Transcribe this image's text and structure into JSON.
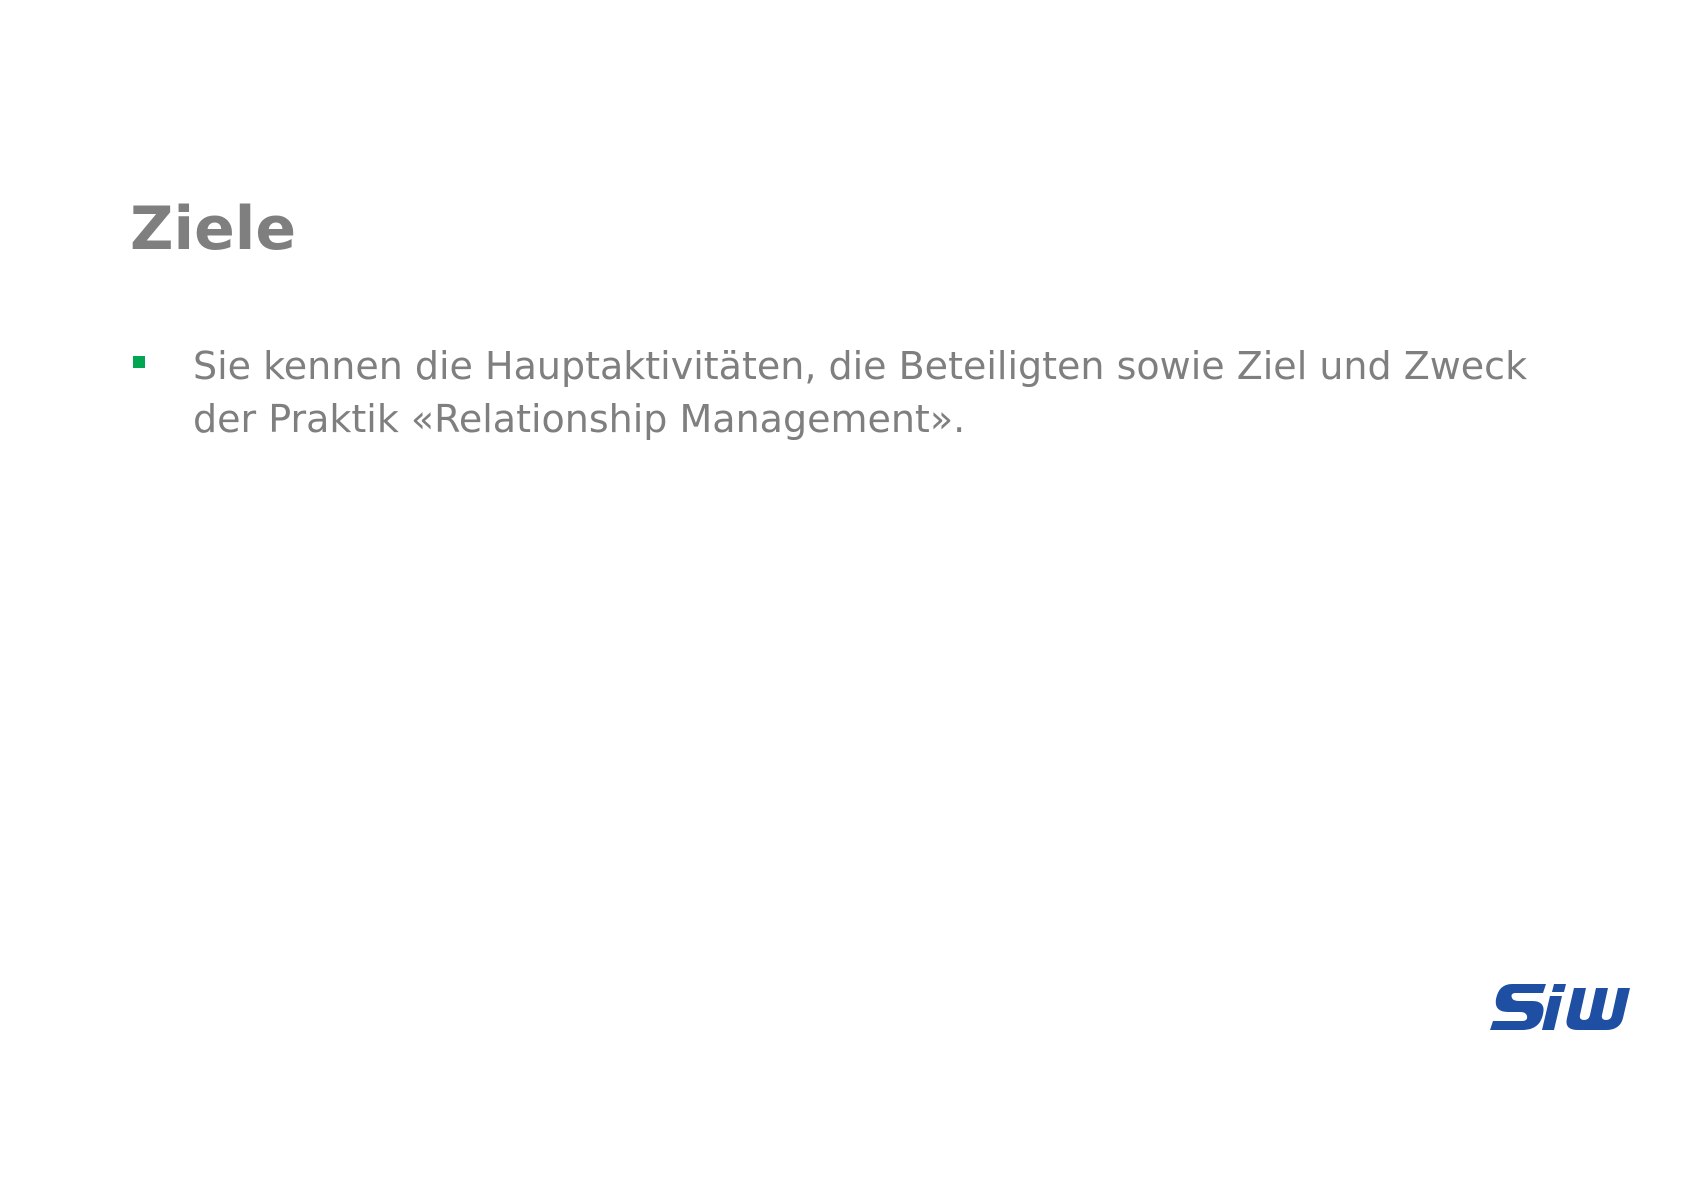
{
  "slide": {
    "title": "Ziele",
    "bullets": [
      {
        "text": "Sie kennen die Hauptaktivitäten, die Beteiligten sowie Ziel und Zweck der Praktik «Relationship Management».",
        "marker_color": "#00a651"
      }
    ]
  },
  "logo": {
    "text": "SiW",
    "icon": "siw-logo-icon",
    "color": "#1f4fa3"
  },
  "colors": {
    "text": "#7f7f7f",
    "accent": "#00a651",
    "brand": "#1f4fa3"
  }
}
